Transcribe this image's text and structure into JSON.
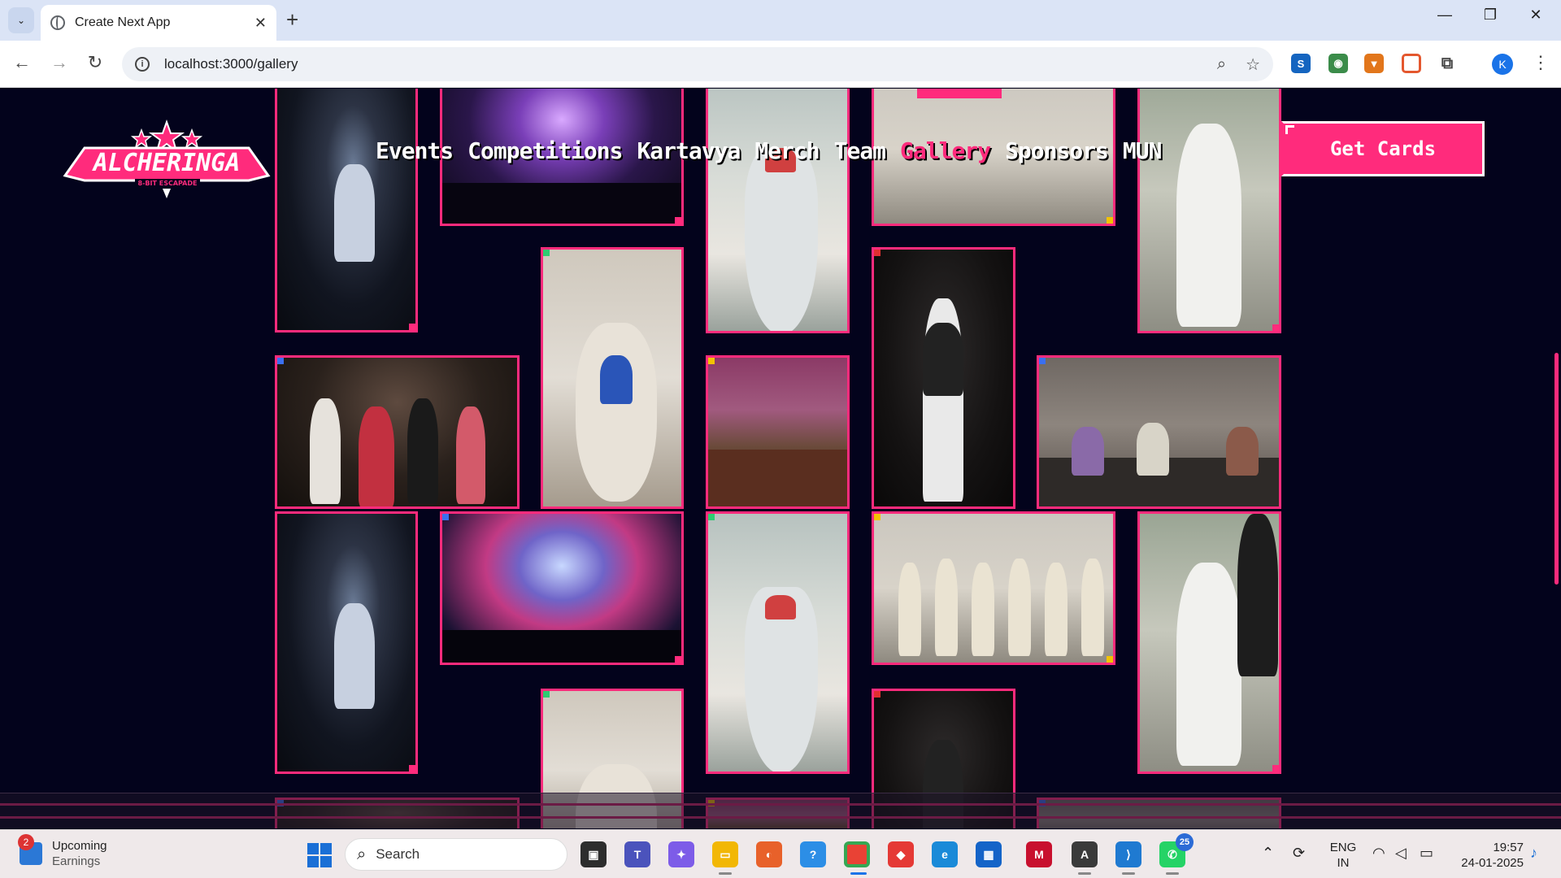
{
  "browser": {
    "tab_title": "Create Next App",
    "tab_close": "✕",
    "new_tab": "+",
    "url": "localhost:3000/gallery",
    "window": {
      "minimize": "—",
      "restore": "❐",
      "close": "✕"
    },
    "profile_initial": "K"
  },
  "site": {
    "nav": [
      "Events",
      "Competitions",
      "Kartavya",
      "Merch",
      "Team",
      "Gallery",
      "Sponsors",
      "MUN"
    ],
    "active_nav": "Gallery",
    "cta": "Get Cards",
    "logo_alt": "ALCHERINGA 8-BIT ESCAPADE",
    "accent": "#ff2b7c",
    "background": "#03031c"
  },
  "gallery": {
    "themes": [
      "night",
      "concert",
      "gown",
      "troupe",
      "whiteout",
      "dance",
      "singer",
      "fashion",
      "classical",
      "summit",
      "panel",
      "stage"
    ]
  },
  "taskbar": {
    "widget_badge": "2",
    "widget_title": "Upcoming",
    "widget_subtitle": "Earnings",
    "search_label": "Search",
    "whatsapp_count": "25",
    "lang_line1": "ENG",
    "lang_line2": "IN",
    "time": "19:57",
    "date": "24-01-2025"
  }
}
